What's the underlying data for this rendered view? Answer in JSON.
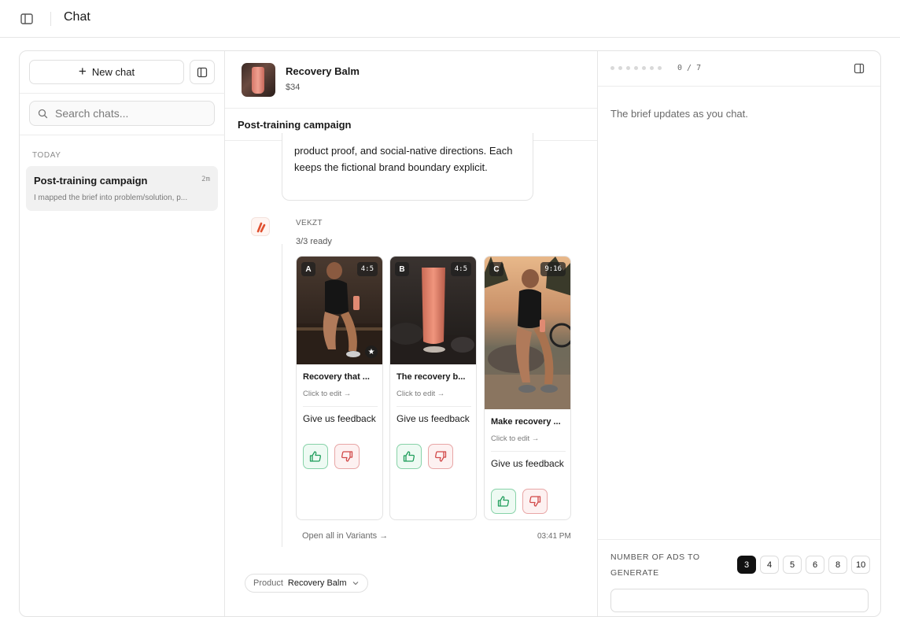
{
  "topbar": {
    "title": "Chat"
  },
  "sidebar": {
    "new_chat_label": "New chat",
    "search_placeholder": "Search chats...",
    "section_label": "TODAY",
    "chats": [
      {
        "title": "Post-training campaign",
        "time": "2m",
        "preview": "I mapped the brief into problem/solution, p..."
      }
    ]
  },
  "product": {
    "name": "Recovery Balm",
    "price": "$34"
  },
  "campaign": {
    "title": "Post-training campaign"
  },
  "thread": {
    "message_text": "product proof, and social-native directions. Each keeps the fictional brand boundary explicit.",
    "agent_name": "VEKZT",
    "ready_status": "3/3 ready",
    "open_all_label": "Open all in Variants →",
    "timestamp": "03:41 PM",
    "variants": [
      {
        "letter": "A",
        "ratio": "4:5",
        "headline": "Recovery that ...",
        "edit_label": "Click to edit →",
        "feedback_label": "Give us feedback",
        "starred": true
      },
      {
        "letter": "B",
        "ratio": "4:5",
        "headline": "The recovery b...",
        "edit_label": "Click to edit →",
        "feedback_label": "Give us feedback",
        "starred": false
      },
      {
        "letter": "C",
        "ratio": "9:16",
        "headline": "Make recovery ...",
        "edit_label": "Click to edit →",
        "feedback_label": "Give us feedback",
        "starred": false
      }
    ]
  },
  "product_pill": {
    "label": "Product",
    "value": "Recovery Balm"
  },
  "brief_panel": {
    "progress_text": "0 / 7",
    "progress_done": 0,
    "progress_total": 7,
    "empty_text": "The brief updates as you chat.",
    "count_label": "NUMBER OF ADS TO GENERATE",
    "count_options": [
      "3",
      "4",
      "5",
      "6",
      "8",
      "10"
    ],
    "count_selected": "3"
  },
  "colors": {
    "accent": "#e0502f",
    "thumb_up": "#1f9d5b",
    "thumb_down": "#d14848",
    "selected_option": "#111111"
  }
}
